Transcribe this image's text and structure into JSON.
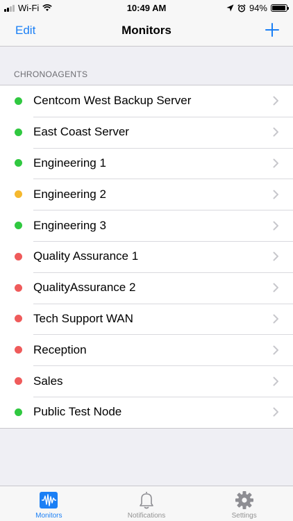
{
  "status_bar": {
    "carrier": "Wi-Fi",
    "time": "10:49 AM",
    "battery": "94%",
    "battery_level": 0.94
  },
  "nav": {
    "edit_label": "Edit",
    "title": "Monitors",
    "add_icon": "plus-icon"
  },
  "section": {
    "header": "CHRONOAGENTS"
  },
  "status_colors": {
    "ok": "#30c840",
    "warning": "#f5b82e",
    "error": "#ef5b5b"
  },
  "monitors": [
    {
      "name": "Centcom West Backup Server",
      "status": "ok"
    },
    {
      "name": "East Coast Server",
      "status": "ok"
    },
    {
      "name": "Engineering 1",
      "status": "ok"
    },
    {
      "name": "Engineering 2",
      "status": "warning"
    },
    {
      "name": "Engineering 3",
      "status": "ok"
    },
    {
      "name": "Quality Assurance 1",
      "status": "error"
    },
    {
      "name": "QualityAssurance 2",
      "status": "error"
    },
    {
      "name": "Tech Support WAN",
      "status": "error"
    },
    {
      "name": "Reception",
      "status": "error"
    },
    {
      "name": "Sales",
      "status": "error"
    },
    {
      "name": "Public Test Node",
      "status": "ok"
    }
  ],
  "tabs": [
    {
      "label": "Monitors",
      "icon": "waveform-icon",
      "active": true
    },
    {
      "label": "Notifications",
      "icon": "bell-icon",
      "active": false
    },
    {
      "label": "Settings",
      "icon": "gear-icon",
      "active": false
    }
  ],
  "accent_color": "#1a7ff5"
}
